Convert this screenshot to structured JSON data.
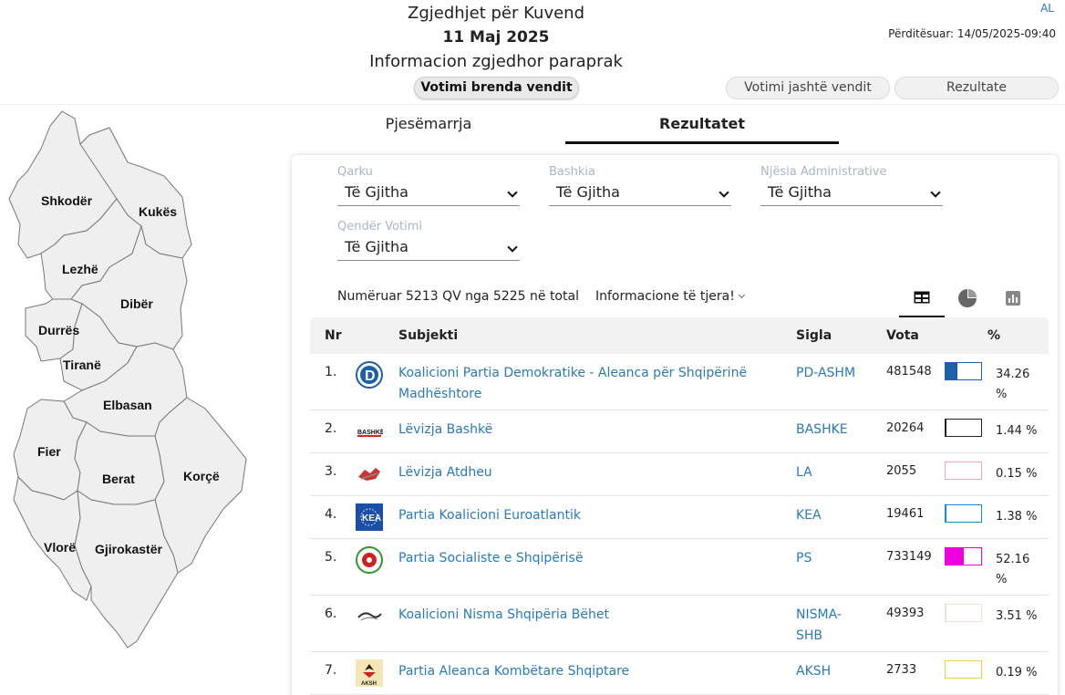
{
  "header": {
    "title": "Zgjedhjet për Kuvend",
    "date": "11 Maj 2025",
    "subtitle": "Informacion zgjedhor paraprak",
    "lang": "AL",
    "updated": "Përditësuar: 14/05/2025-09:40",
    "buttons": [
      "Votimi brenda vendit",
      "Votimi jashtë vendit",
      "Rezultate"
    ]
  },
  "map": {
    "regions": [
      "Shkodër",
      "Kukës",
      "Lezhë",
      "Dibër",
      "Durrës",
      "Tiranë",
      "Elbasan",
      "Fier",
      "Berat",
      "Korçë",
      "Vlorë",
      "Gjirokastër"
    ]
  },
  "tabs": [
    "Pjesëmarrja",
    "Rezultatet"
  ],
  "filters": [
    {
      "label": "Qarku",
      "value": "Të Gjitha"
    },
    {
      "label": "Bashkia",
      "value": "Të Gjitha"
    },
    {
      "label": "Njësia Administrative",
      "value": "Të Gjitha"
    },
    {
      "label": "Qendër Votimi",
      "value": "Të Gjitha"
    }
  ],
  "counted": "Numëruar 5213 QV nga 5225 në total",
  "more_info": "Informacione të tjera!",
  "table": {
    "headers": [
      "Nr",
      "Subjekti",
      "Sigla",
      "Vota",
      "%"
    ],
    "rows": [
      {
        "nr": "1.",
        "subject": "Koalicioni Partia Demokratike - Aleanca për Shqipërinë Madhështore",
        "sigla": "PD-ASHM",
        "votes": "481548",
        "pct": "34.26 %",
        "share": 0.3426,
        "color": "#1f5fa8",
        "logo": "pd-logo-icon"
      },
      {
        "nr": "2.",
        "subject": "Lëvizja Bashkë",
        "sigla": "BASHKE",
        "votes": "20264",
        "pct": "1.44 %",
        "share": 0.0144,
        "color": "#222222",
        "logo": "bashke-logo-icon"
      },
      {
        "nr": "3.",
        "subject": "Lëvizja Atdheu",
        "sigla": "LA",
        "votes": "2055",
        "pct": "0.15 %",
        "share": 0.0015,
        "color": "#e7a6c6",
        "logo": "la-logo-icon"
      },
      {
        "nr": "4.",
        "subject": "Partia Koalicioni Euroatlantik",
        "sigla": "KEA",
        "votes": "19461",
        "pct": "1.38 %",
        "share": 0.0138,
        "color": "#1b8ad6",
        "logo": "kea-logo-icon"
      },
      {
        "nr": "5.",
        "subject": "Partia Socialiste e Shqipërisë",
        "sigla": "PS",
        "votes": "733149",
        "pct": "52.16 %",
        "share": 0.5216,
        "color": "#ee00dd",
        "logo": "ps-logo-icon"
      },
      {
        "nr": "6.",
        "subject": "Koalicioni Nisma Shqipëria Bëhet",
        "sigla": "NISMA-SHB",
        "votes": "49393",
        "pct": "3.51 %",
        "share": 0.0351,
        "color": "#f1e4cf",
        "logo": "nisma-logo-icon"
      },
      {
        "nr": "7.",
        "subject": "Partia Aleanca Kombëtare Shqiptare",
        "sigla": "AKSH",
        "votes": "2733",
        "pct": "0.19 %",
        "share": 0.0019,
        "color": "#f0d24a",
        "logo": "aksh-logo-icon"
      }
    ]
  }
}
